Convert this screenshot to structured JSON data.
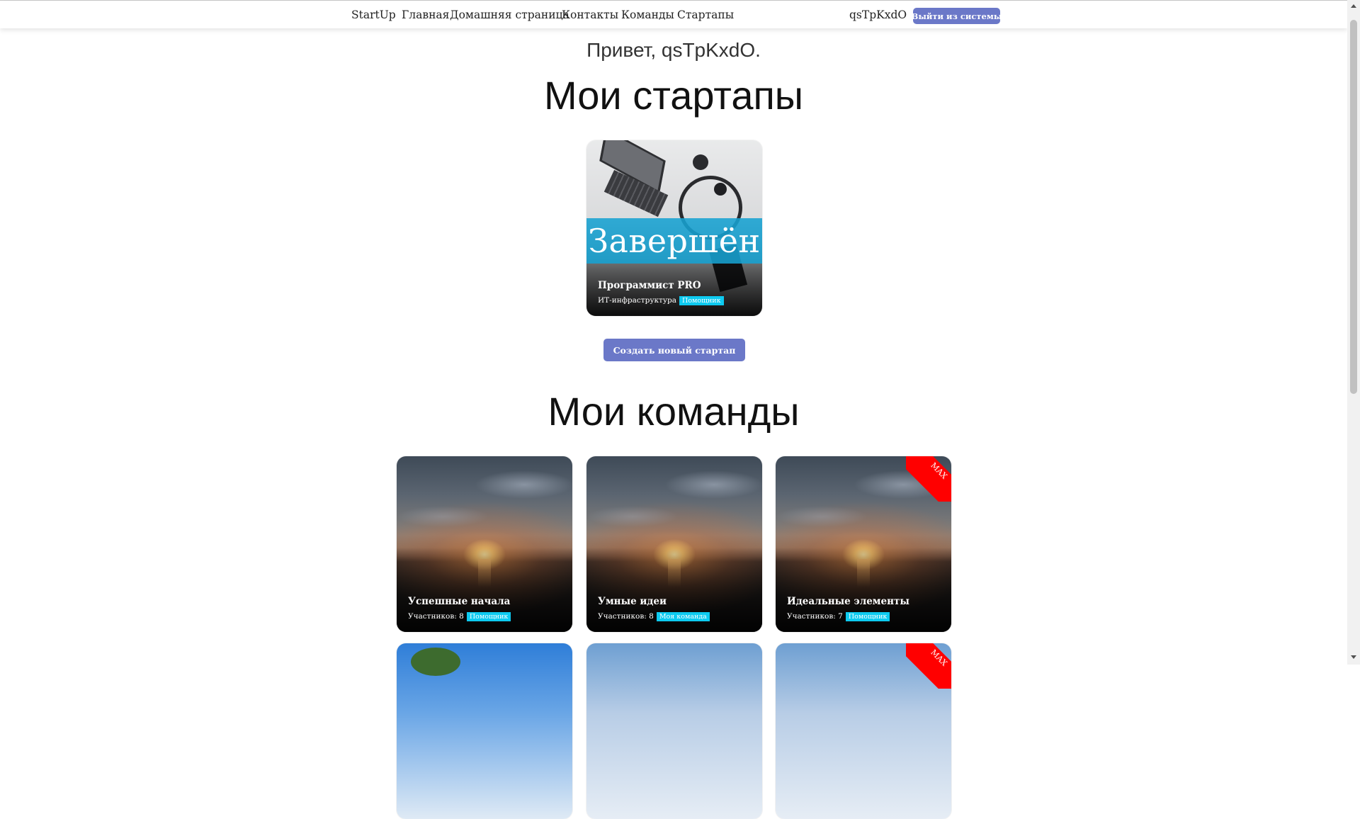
{
  "nav": {
    "brand": "StartUp",
    "links": [
      "Главная",
      "Домашняя страница",
      "Контакты",
      "Команды",
      "Стартапы"
    ],
    "username": "qsTpKxdO",
    "logout_label": "Выйти из системы"
  },
  "greeting": "Привет, qsTpKxdO.",
  "startups": {
    "heading": "Мои стартапы",
    "items": [
      {
        "status_overlay": "Завершён",
        "title": "Программист PRO",
        "category": "ИТ-инфраструктура",
        "role_badge": "Помощник"
      }
    ],
    "create_label": "Создать новый стартап"
  },
  "teams": {
    "heading": "Мои команды",
    "items": [
      {
        "title": "Успешные начала",
        "members_label": "Участников: 8",
        "role_badge": "Помощник",
        "max": false
      },
      {
        "title": "Умные идеи",
        "members_label": "Участников: 8",
        "role_badge": "Моя команда",
        "max": false
      },
      {
        "title": "Идеальные элементы",
        "members_label": "Участников: 7",
        "role_badge": "Помощник",
        "max": true,
        "max_label": "MAX"
      },
      {
        "max": false
      },
      {
        "max": false
      },
      {
        "max": true,
        "max_label": "MAX"
      }
    ]
  },
  "colors": {
    "primary_button": "#6b78c8",
    "badge": "#0dcaf0",
    "status_band": "#17a2d1",
    "max_ribbon": "#ff0000"
  }
}
